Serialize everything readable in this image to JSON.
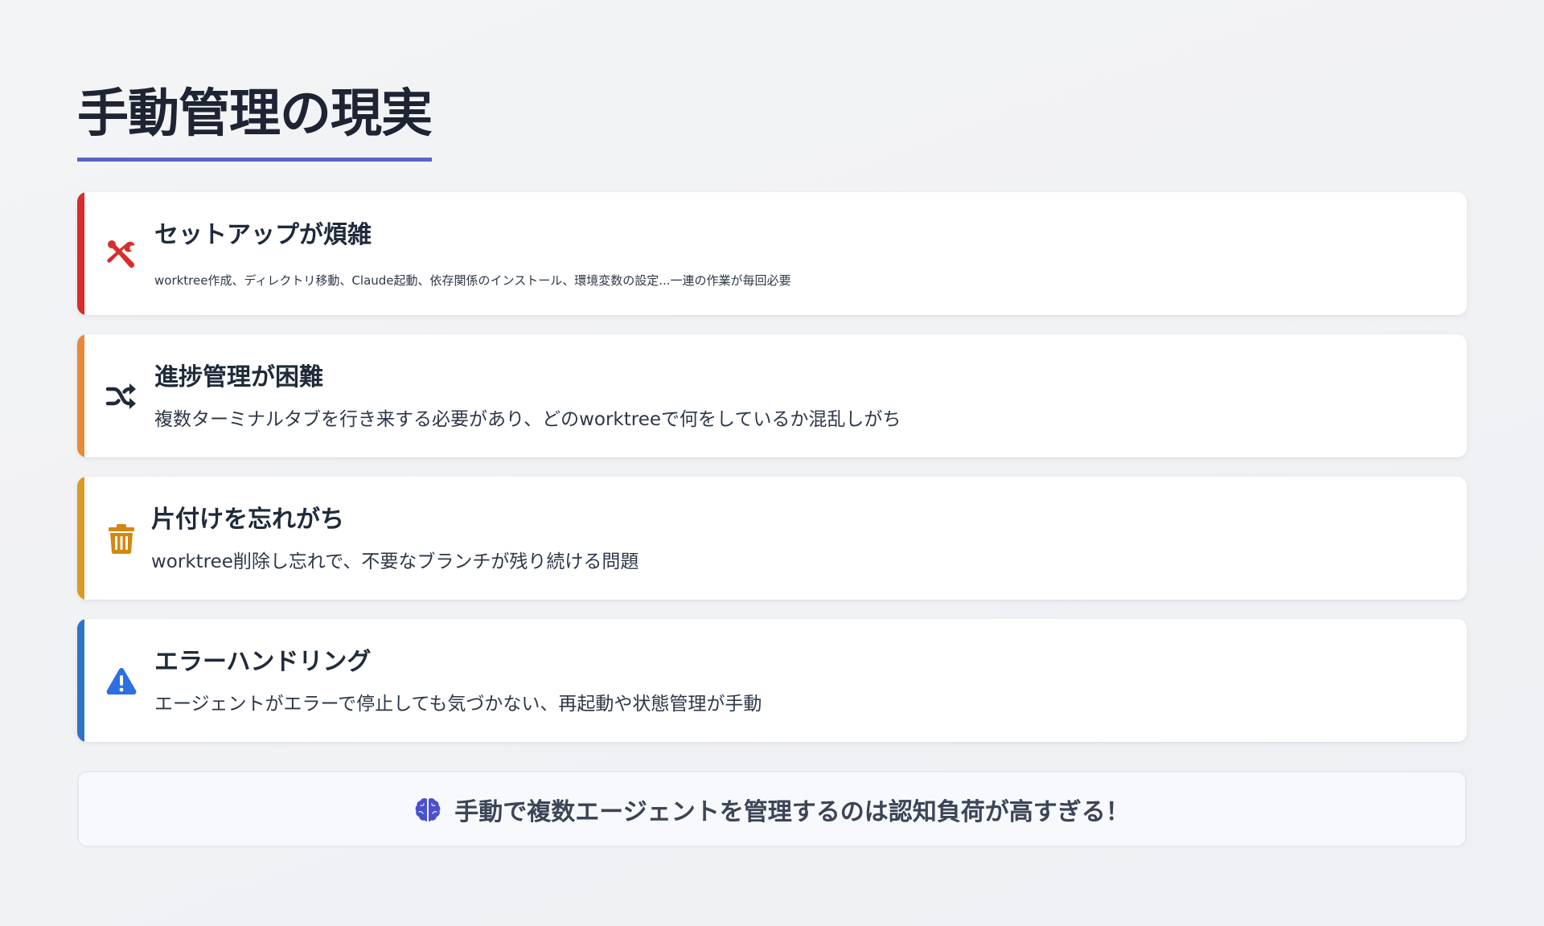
{
  "slide": {
    "title": "手動管理の現実",
    "cards": [
      {
        "icon": "tools-icon",
        "color": "#d92c2c",
        "heading": "セットアップが煩雑",
        "description": "worktree作成、ディレクトリ移動、Claude起動、依存関係のインストール、環境変数の設定...一連の作業が毎回必要"
      },
      {
        "icon": "shuffle-icon",
        "color": "#e8893a",
        "heading": "進捗管理が困難",
        "description": "複数ターミナルタブを行き来する必要があり、どのworktreeで何をしているか混乱しがち"
      },
      {
        "icon": "trash-icon",
        "color": "#d99a26",
        "heading": "片付けを忘れがち",
        "description": "worktree削除し忘れで、不要なブランチが残り続ける問題"
      },
      {
        "icon": "warning-icon",
        "color": "#2f73c4",
        "heading": "エラーハンドリング",
        "description": "エージェントがエラーで停止しても気づかない、再起動や状態管理が手動"
      }
    ],
    "callout": {
      "icon": "brain-icon",
      "color": "#4a4fd1",
      "text": "手動で複数エージェントを管理するのは認知負荷が高すぎる！"
    }
  }
}
